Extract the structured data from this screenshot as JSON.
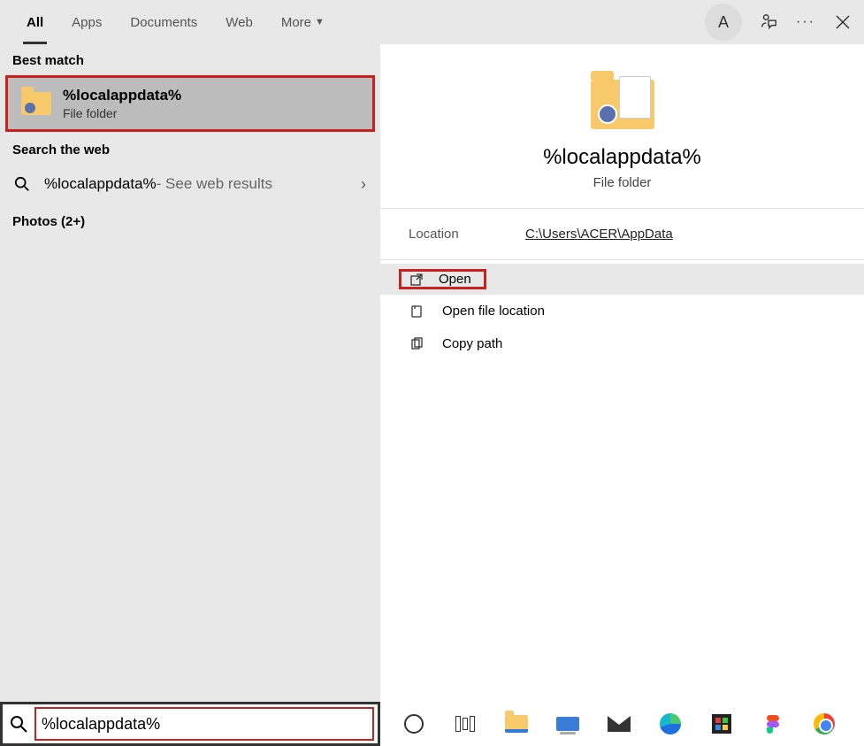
{
  "header": {
    "tabs": {
      "all": "All",
      "apps": "Apps",
      "documents": "Documents",
      "web": "Web",
      "more": "More"
    },
    "avatar_initial": "A"
  },
  "left": {
    "best_match_label": "Best match",
    "best_match": {
      "title": "%localappdata%",
      "subtitle": "File folder"
    },
    "search_web_label": "Search the web",
    "web_term": "%localappdata%",
    "web_suffix": " - See web results",
    "photos_label": "Photos (2+)"
  },
  "preview": {
    "title": "%localappdata%",
    "subtitle": "File folder",
    "location_label": "Location",
    "location_value": "C:\\Users\\ACER\\AppData",
    "actions": {
      "open": "Open",
      "open_location": "Open file location",
      "copy_path": "Copy path"
    }
  },
  "search": {
    "value": "%localappdata%"
  }
}
